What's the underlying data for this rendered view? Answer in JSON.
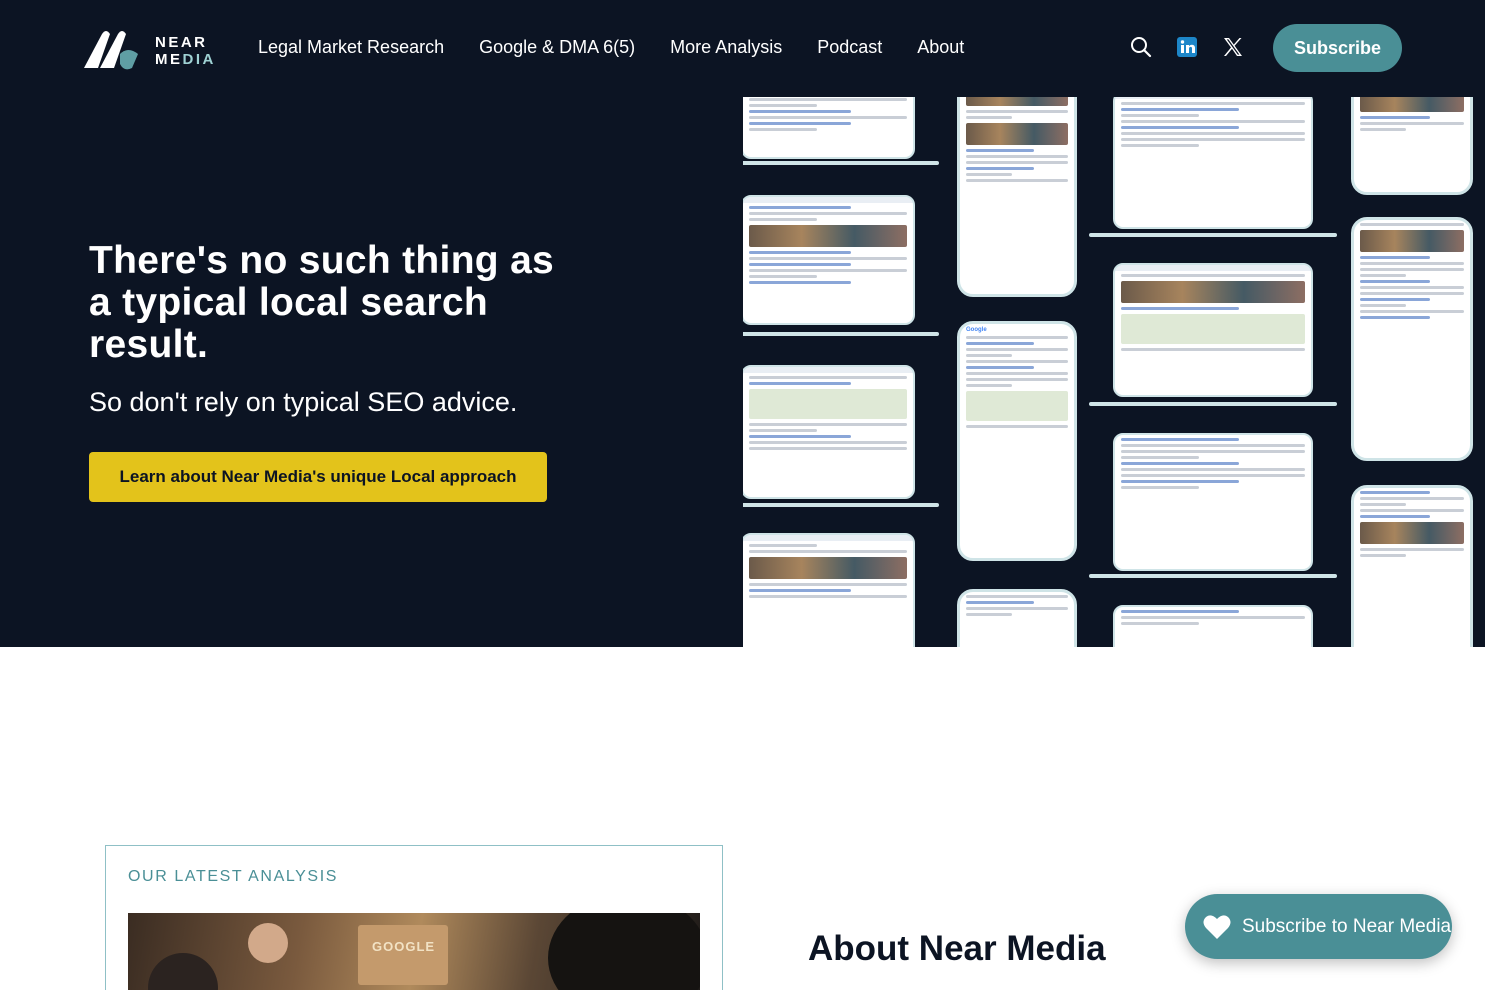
{
  "brand": {
    "logo_line1": "NEAR",
    "logo_line2_a": "ME",
    "logo_line2_b": "DIA",
    "accent_color": "#4a8f96",
    "cta_color": "#e3c31b",
    "dark_bg": "#0c1423"
  },
  "nav": {
    "items": [
      {
        "label": "Legal Market Research"
      },
      {
        "label": "Google & DMA 6(5)"
      },
      {
        "label": "More Analysis"
      },
      {
        "label": "Podcast"
      },
      {
        "label": "About"
      }
    ],
    "icons": [
      "search-icon",
      "linkedin-icon",
      "x-twitter-icon"
    ],
    "subscribe_label": "Subscribe"
  },
  "hero": {
    "title": "There's no such thing as a typical local search result.",
    "subtitle": "So don't rely on typical SEO advice.",
    "cta_label": "Learn about Near Media's unique Local approach",
    "collage_google": "Google"
  },
  "analysis": {
    "label": "OUR LATEST ANALYSIS",
    "image_sign": "GOOGLE"
  },
  "about": {
    "heading": "About Near Media"
  },
  "floating": {
    "subscribe_label": "Subscribe to Near Media",
    "icon": "heart-icon"
  }
}
